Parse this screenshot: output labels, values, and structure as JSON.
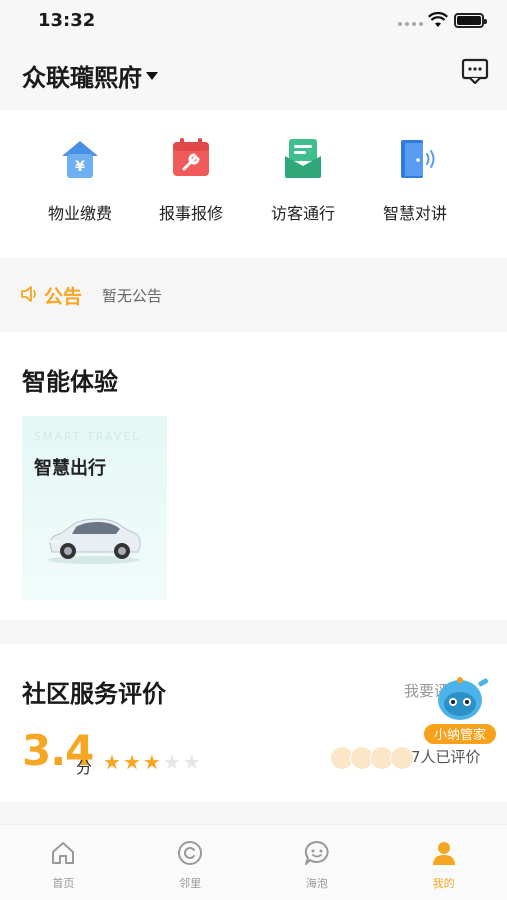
{
  "status_bar": {
    "time": "13:32"
  },
  "header": {
    "community_name": "众联瓏熙府"
  },
  "quick_actions": [
    {
      "label": "物业缴费",
      "icon": "property-fee-icon"
    },
    {
      "label": "报事报修",
      "icon": "repair-icon"
    },
    {
      "label": "访客通行",
      "icon": "visitor-pass-icon"
    },
    {
      "label": "智慧对讲",
      "icon": "intercom-icon"
    }
  ],
  "notice": {
    "tag": "公告",
    "text": "暂无公告"
  },
  "smart_experience": {
    "title": "智能体验",
    "card": {
      "eng_label": "SMART TRAVEL",
      "title": "智慧出行"
    }
  },
  "rating": {
    "title": "社区服务评价",
    "action": "我要评",
    "score": "3.4",
    "unit": "分",
    "stars": 3.4,
    "star_count": 5,
    "count_text": "7人已评价"
  },
  "assistant": {
    "label": "小纳管家"
  },
  "tabs": [
    {
      "label": "首页",
      "icon": "home-icon"
    },
    {
      "label": "邻里",
      "icon": "neighbor-icon"
    },
    {
      "label": "海泡",
      "icon": "chat-icon"
    },
    {
      "label": "我的",
      "icon": "profile-icon",
      "active": true
    }
  ],
  "colors": {
    "accent": "#f5a623",
    "background": "#f6f6f6"
  }
}
